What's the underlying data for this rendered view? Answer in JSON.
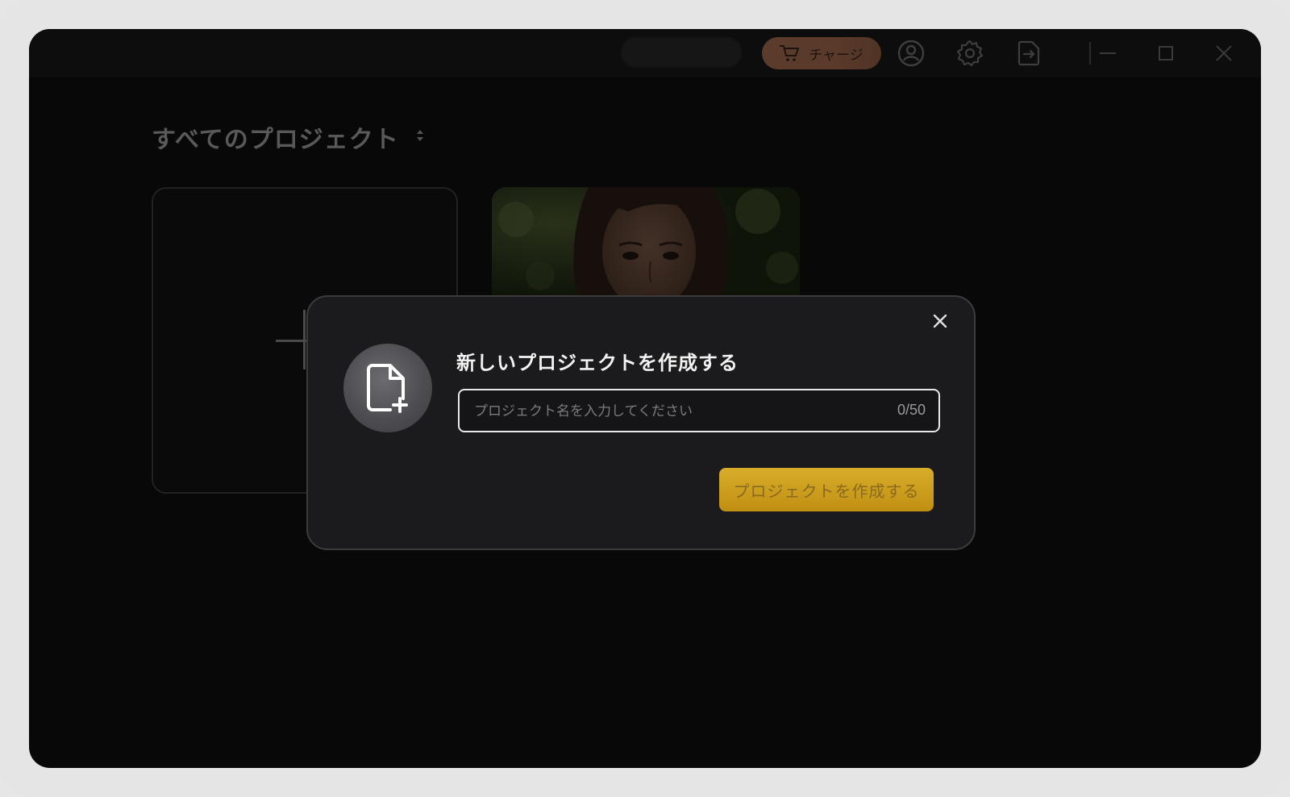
{
  "titlebar": {
    "promo_pill_label": "",
    "charge_label": "チャージ",
    "icons": [
      "account-icon",
      "settings-icon",
      "logout-icon",
      "minimize-icon",
      "maximize-icon",
      "close-icon"
    ]
  },
  "main": {
    "section_title": "すべてのプロジェクト"
  },
  "dialog": {
    "title": "新しいプロジェクトを作成する",
    "input_placeholder": "プロジェクト名を入力してください",
    "input_value": "",
    "counter": "0/50",
    "create_button_label": "プロジェクトを作成する"
  },
  "colors": {
    "accent_gold": "#d8ad2a",
    "charge_bg": "#5b3c2c",
    "app_bg": "#080808",
    "dialog_bg": "#1b1b1d"
  }
}
